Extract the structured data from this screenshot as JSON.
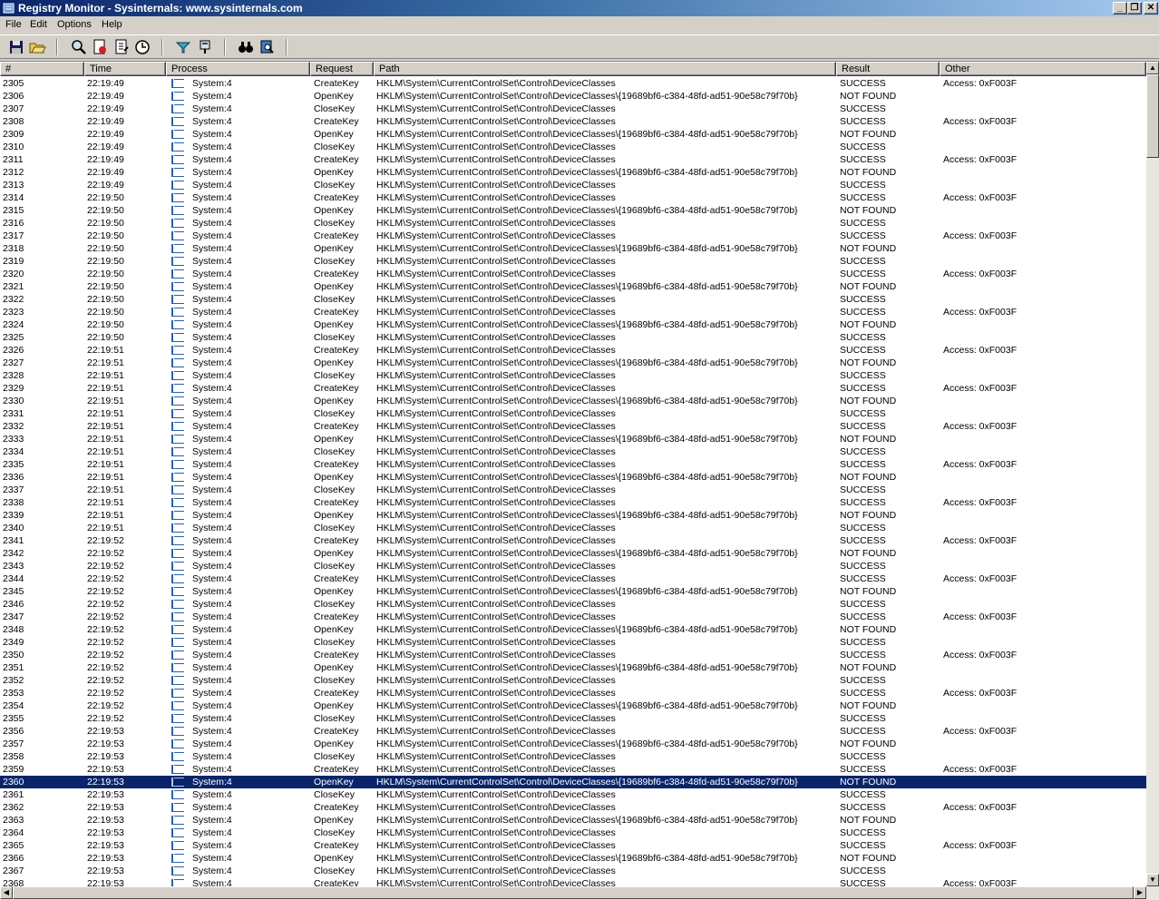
{
  "window": {
    "title": "Registry Monitor - Sysinternals: www.sysinternals.com",
    "min_glyph": "_",
    "max_glyph": "❐",
    "close_glyph": "✕"
  },
  "menu": [
    "File",
    "Edit",
    "Options",
    "Help"
  ],
  "toolbar": {
    "buttons": [
      "save-icon",
      "open-icon",
      "find-icon",
      "capture-icon",
      "autoscroll-icon",
      "clock-icon",
      "filter-icon",
      "highlight-icon",
      "search-icon",
      "jump-icon"
    ]
  },
  "columns": [
    "#",
    "Time",
    "Process",
    "Request",
    "Path",
    "Result",
    "Other"
  ],
  "scroll_glyphs": {
    "up": "▲",
    "down": "▼",
    "left": "◀",
    "right": "▶"
  },
  "selected_row": "2360",
  "rows": [
    [
      "2305",
      "22:19:49",
      "System:4",
      "CreateKey",
      "HKLM\\System\\CurrentControlSet\\Control\\DeviceClasses",
      "SUCCESS",
      "Access: 0xF003F"
    ],
    [
      "2306",
      "22:19:49",
      "System:4",
      "OpenKey",
      "HKLM\\System\\CurrentControlSet\\Control\\DeviceClasses\\{19689bf6-c384-48fd-ad51-90e58c79f70b}",
      "NOT FOUND",
      ""
    ],
    [
      "2307",
      "22:19:49",
      "System:4",
      "CloseKey",
      "HKLM\\System\\CurrentControlSet\\Control\\DeviceClasses",
      "SUCCESS",
      ""
    ],
    [
      "2308",
      "22:19:49",
      "System:4",
      "CreateKey",
      "HKLM\\System\\CurrentControlSet\\Control\\DeviceClasses",
      "SUCCESS",
      "Access: 0xF003F"
    ],
    [
      "2309",
      "22:19:49",
      "System:4",
      "OpenKey",
      "HKLM\\System\\CurrentControlSet\\Control\\DeviceClasses\\{19689bf6-c384-48fd-ad51-90e58c79f70b}",
      "NOT FOUND",
      ""
    ],
    [
      "2310",
      "22:19:49",
      "System:4",
      "CloseKey",
      "HKLM\\System\\CurrentControlSet\\Control\\DeviceClasses",
      "SUCCESS",
      ""
    ],
    [
      "2311",
      "22:19:49",
      "System:4",
      "CreateKey",
      "HKLM\\System\\CurrentControlSet\\Control\\DeviceClasses",
      "SUCCESS",
      "Access: 0xF003F"
    ],
    [
      "2312",
      "22:19:49",
      "System:4",
      "OpenKey",
      "HKLM\\System\\CurrentControlSet\\Control\\DeviceClasses\\{19689bf6-c384-48fd-ad51-90e58c79f70b}",
      "NOT FOUND",
      ""
    ],
    [
      "2313",
      "22:19:49",
      "System:4",
      "CloseKey",
      "HKLM\\System\\CurrentControlSet\\Control\\DeviceClasses",
      "SUCCESS",
      ""
    ],
    [
      "2314",
      "22:19:50",
      "System:4",
      "CreateKey",
      "HKLM\\System\\CurrentControlSet\\Control\\DeviceClasses",
      "SUCCESS",
      "Access: 0xF003F"
    ],
    [
      "2315",
      "22:19:50",
      "System:4",
      "OpenKey",
      "HKLM\\System\\CurrentControlSet\\Control\\DeviceClasses\\{19689bf6-c384-48fd-ad51-90e58c79f70b}",
      "NOT FOUND",
      ""
    ],
    [
      "2316",
      "22:19:50",
      "System:4",
      "CloseKey",
      "HKLM\\System\\CurrentControlSet\\Control\\DeviceClasses",
      "SUCCESS",
      ""
    ],
    [
      "2317",
      "22:19:50",
      "System:4",
      "CreateKey",
      "HKLM\\System\\CurrentControlSet\\Control\\DeviceClasses",
      "SUCCESS",
      "Access: 0xF003F"
    ],
    [
      "2318",
      "22:19:50",
      "System:4",
      "OpenKey",
      "HKLM\\System\\CurrentControlSet\\Control\\DeviceClasses\\{19689bf6-c384-48fd-ad51-90e58c79f70b}",
      "NOT FOUND",
      ""
    ],
    [
      "2319",
      "22:19:50",
      "System:4",
      "CloseKey",
      "HKLM\\System\\CurrentControlSet\\Control\\DeviceClasses",
      "SUCCESS",
      ""
    ],
    [
      "2320",
      "22:19:50",
      "System:4",
      "CreateKey",
      "HKLM\\System\\CurrentControlSet\\Control\\DeviceClasses",
      "SUCCESS",
      "Access: 0xF003F"
    ],
    [
      "2321",
      "22:19:50",
      "System:4",
      "OpenKey",
      "HKLM\\System\\CurrentControlSet\\Control\\DeviceClasses\\{19689bf6-c384-48fd-ad51-90e58c79f70b}",
      "NOT FOUND",
      ""
    ],
    [
      "2322",
      "22:19:50",
      "System:4",
      "CloseKey",
      "HKLM\\System\\CurrentControlSet\\Control\\DeviceClasses",
      "SUCCESS",
      ""
    ],
    [
      "2323",
      "22:19:50",
      "System:4",
      "CreateKey",
      "HKLM\\System\\CurrentControlSet\\Control\\DeviceClasses",
      "SUCCESS",
      "Access: 0xF003F"
    ],
    [
      "2324",
      "22:19:50",
      "System:4",
      "OpenKey",
      "HKLM\\System\\CurrentControlSet\\Control\\DeviceClasses\\{19689bf6-c384-48fd-ad51-90e58c79f70b}",
      "NOT FOUND",
      ""
    ],
    [
      "2325",
      "22:19:50",
      "System:4",
      "CloseKey",
      "HKLM\\System\\CurrentControlSet\\Control\\DeviceClasses",
      "SUCCESS",
      ""
    ],
    [
      "2326",
      "22:19:51",
      "System:4",
      "CreateKey",
      "HKLM\\System\\CurrentControlSet\\Control\\DeviceClasses",
      "SUCCESS",
      "Access: 0xF003F"
    ],
    [
      "2327",
      "22:19:51",
      "System:4",
      "OpenKey",
      "HKLM\\System\\CurrentControlSet\\Control\\DeviceClasses\\{19689bf6-c384-48fd-ad51-90e58c79f70b}",
      "NOT FOUND",
      ""
    ],
    [
      "2328",
      "22:19:51",
      "System:4",
      "CloseKey",
      "HKLM\\System\\CurrentControlSet\\Control\\DeviceClasses",
      "SUCCESS",
      ""
    ],
    [
      "2329",
      "22:19:51",
      "System:4",
      "CreateKey",
      "HKLM\\System\\CurrentControlSet\\Control\\DeviceClasses",
      "SUCCESS",
      "Access: 0xF003F"
    ],
    [
      "2330",
      "22:19:51",
      "System:4",
      "OpenKey",
      "HKLM\\System\\CurrentControlSet\\Control\\DeviceClasses\\{19689bf6-c384-48fd-ad51-90e58c79f70b}",
      "NOT FOUND",
      ""
    ],
    [
      "2331",
      "22:19:51",
      "System:4",
      "CloseKey",
      "HKLM\\System\\CurrentControlSet\\Control\\DeviceClasses",
      "SUCCESS",
      ""
    ],
    [
      "2332",
      "22:19:51",
      "System:4",
      "CreateKey",
      "HKLM\\System\\CurrentControlSet\\Control\\DeviceClasses",
      "SUCCESS",
      "Access: 0xF003F"
    ],
    [
      "2333",
      "22:19:51",
      "System:4",
      "OpenKey",
      "HKLM\\System\\CurrentControlSet\\Control\\DeviceClasses\\{19689bf6-c384-48fd-ad51-90e58c79f70b}",
      "NOT FOUND",
      ""
    ],
    [
      "2334",
      "22:19:51",
      "System:4",
      "CloseKey",
      "HKLM\\System\\CurrentControlSet\\Control\\DeviceClasses",
      "SUCCESS",
      ""
    ],
    [
      "2335",
      "22:19:51",
      "System:4",
      "CreateKey",
      "HKLM\\System\\CurrentControlSet\\Control\\DeviceClasses",
      "SUCCESS",
      "Access: 0xF003F"
    ],
    [
      "2336",
      "22:19:51",
      "System:4",
      "OpenKey",
      "HKLM\\System\\CurrentControlSet\\Control\\DeviceClasses\\{19689bf6-c384-48fd-ad51-90e58c79f70b}",
      "NOT FOUND",
      ""
    ],
    [
      "2337",
      "22:19:51",
      "System:4",
      "CloseKey",
      "HKLM\\System\\CurrentControlSet\\Control\\DeviceClasses",
      "SUCCESS",
      ""
    ],
    [
      "2338",
      "22:19:51",
      "System:4",
      "CreateKey",
      "HKLM\\System\\CurrentControlSet\\Control\\DeviceClasses",
      "SUCCESS",
      "Access: 0xF003F"
    ],
    [
      "2339",
      "22:19:51",
      "System:4",
      "OpenKey",
      "HKLM\\System\\CurrentControlSet\\Control\\DeviceClasses\\{19689bf6-c384-48fd-ad51-90e58c79f70b}",
      "NOT FOUND",
      ""
    ],
    [
      "2340",
      "22:19:51",
      "System:4",
      "CloseKey",
      "HKLM\\System\\CurrentControlSet\\Control\\DeviceClasses",
      "SUCCESS",
      ""
    ],
    [
      "2341",
      "22:19:52",
      "System:4",
      "CreateKey",
      "HKLM\\System\\CurrentControlSet\\Control\\DeviceClasses",
      "SUCCESS",
      "Access: 0xF003F"
    ],
    [
      "2342",
      "22:19:52",
      "System:4",
      "OpenKey",
      "HKLM\\System\\CurrentControlSet\\Control\\DeviceClasses\\{19689bf6-c384-48fd-ad51-90e58c79f70b}",
      "NOT FOUND",
      ""
    ],
    [
      "2343",
      "22:19:52",
      "System:4",
      "CloseKey",
      "HKLM\\System\\CurrentControlSet\\Control\\DeviceClasses",
      "SUCCESS",
      ""
    ],
    [
      "2344",
      "22:19:52",
      "System:4",
      "CreateKey",
      "HKLM\\System\\CurrentControlSet\\Control\\DeviceClasses",
      "SUCCESS",
      "Access: 0xF003F"
    ],
    [
      "2345",
      "22:19:52",
      "System:4",
      "OpenKey",
      "HKLM\\System\\CurrentControlSet\\Control\\DeviceClasses\\{19689bf6-c384-48fd-ad51-90e58c79f70b}",
      "NOT FOUND",
      ""
    ],
    [
      "2346",
      "22:19:52",
      "System:4",
      "CloseKey",
      "HKLM\\System\\CurrentControlSet\\Control\\DeviceClasses",
      "SUCCESS",
      ""
    ],
    [
      "2347",
      "22:19:52",
      "System:4",
      "CreateKey",
      "HKLM\\System\\CurrentControlSet\\Control\\DeviceClasses",
      "SUCCESS",
      "Access: 0xF003F"
    ],
    [
      "2348",
      "22:19:52",
      "System:4",
      "OpenKey",
      "HKLM\\System\\CurrentControlSet\\Control\\DeviceClasses\\{19689bf6-c384-48fd-ad51-90e58c79f70b}",
      "NOT FOUND",
      ""
    ],
    [
      "2349",
      "22:19:52",
      "System:4",
      "CloseKey",
      "HKLM\\System\\CurrentControlSet\\Control\\DeviceClasses",
      "SUCCESS",
      ""
    ],
    [
      "2350",
      "22:19:52",
      "System:4",
      "CreateKey",
      "HKLM\\System\\CurrentControlSet\\Control\\DeviceClasses",
      "SUCCESS",
      "Access: 0xF003F"
    ],
    [
      "2351",
      "22:19:52",
      "System:4",
      "OpenKey",
      "HKLM\\System\\CurrentControlSet\\Control\\DeviceClasses\\{19689bf6-c384-48fd-ad51-90e58c79f70b}",
      "NOT FOUND",
      ""
    ],
    [
      "2352",
      "22:19:52",
      "System:4",
      "CloseKey",
      "HKLM\\System\\CurrentControlSet\\Control\\DeviceClasses",
      "SUCCESS",
      ""
    ],
    [
      "2353",
      "22:19:52",
      "System:4",
      "CreateKey",
      "HKLM\\System\\CurrentControlSet\\Control\\DeviceClasses",
      "SUCCESS",
      "Access: 0xF003F"
    ],
    [
      "2354",
      "22:19:52",
      "System:4",
      "OpenKey",
      "HKLM\\System\\CurrentControlSet\\Control\\DeviceClasses\\{19689bf6-c384-48fd-ad51-90e58c79f70b}",
      "NOT FOUND",
      ""
    ],
    [
      "2355",
      "22:19:52",
      "System:4",
      "CloseKey",
      "HKLM\\System\\CurrentControlSet\\Control\\DeviceClasses",
      "SUCCESS",
      ""
    ],
    [
      "2356",
      "22:19:53",
      "System:4",
      "CreateKey",
      "HKLM\\System\\CurrentControlSet\\Control\\DeviceClasses",
      "SUCCESS",
      "Access: 0xF003F"
    ],
    [
      "2357",
      "22:19:53",
      "System:4",
      "OpenKey",
      "HKLM\\System\\CurrentControlSet\\Control\\DeviceClasses\\{19689bf6-c384-48fd-ad51-90e58c79f70b}",
      "NOT FOUND",
      ""
    ],
    [
      "2358",
      "22:19:53",
      "System:4",
      "CloseKey",
      "HKLM\\System\\CurrentControlSet\\Control\\DeviceClasses",
      "SUCCESS",
      ""
    ],
    [
      "2359",
      "22:19:53",
      "System:4",
      "CreateKey",
      "HKLM\\System\\CurrentControlSet\\Control\\DeviceClasses",
      "SUCCESS",
      "Access: 0xF003F"
    ],
    [
      "2360",
      "22:19:53",
      "System:4",
      "OpenKey",
      "HKLM\\System\\CurrentControlSet\\Control\\DeviceClasses\\{19689bf6-c384-48fd-ad51-90e58c79f70b}",
      "NOT FOUND",
      ""
    ],
    [
      "2361",
      "22:19:53",
      "System:4",
      "CloseKey",
      "HKLM\\System\\CurrentControlSet\\Control\\DeviceClasses",
      "SUCCESS",
      ""
    ],
    [
      "2362",
      "22:19:53",
      "System:4",
      "CreateKey",
      "HKLM\\System\\CurrentControlSet\\Control\\DeviceClasses",
      "SUCCESS",
      "Access: 0xF003F"
    ],
    [
      "2363",
      "22:19:53",
      "System:4",
      "OpenKey",
      "HKLM\\System\\CurrentControlSet\\Control\\DeviceClasses\\{19689bf6-c384-48fd-ad51-90e58c79f70b}",
      "NOT FOUND",
      ""
    ],
    [
      "2364",
      "22:19:53",
      "System:4",
      "CloseKey",
      "HKLM\\System\\CurrentControlSet\\Control\\DeviceClasses",
      "SUCCESS",
      ""
    ],
    [
      "2365",
      "22:19:53",
      "System:4",
      "CreateKey",
      "HKLM\\System\\CurrentControlSet\\Control\\DeviceClasses",
      "SUCCESS",
      "Access: 0xF003F"
    ],
    [
      "2366",
      "22:19:53",
      "System:4",
      "OpenKey",
      "HKLM\\System\\CurrentControlSet\\Control\\DeviceClasses\\{19689bf6-c384-48fd-ad51-90e58c79f70b}",
      "NOT FOUND",
      ""
    ],
    [
      "2367",
      "22:19:53",
      "System:4",
      "CloseKey",
      "HKLM\\System\\CurrentControlSet\\Control\\DeviceClasses",
      "SUCCESS",
      ""
    ],
    [
      "2368",
      "22:19:53",
      "System:4",
      "CreateKey",
      "HKLM\\System\\CurrentControlSet\\Control\\DeviceClasses",
      "SUCCESS",
      "Access: 0xF003F"
    ]
  ]
}
